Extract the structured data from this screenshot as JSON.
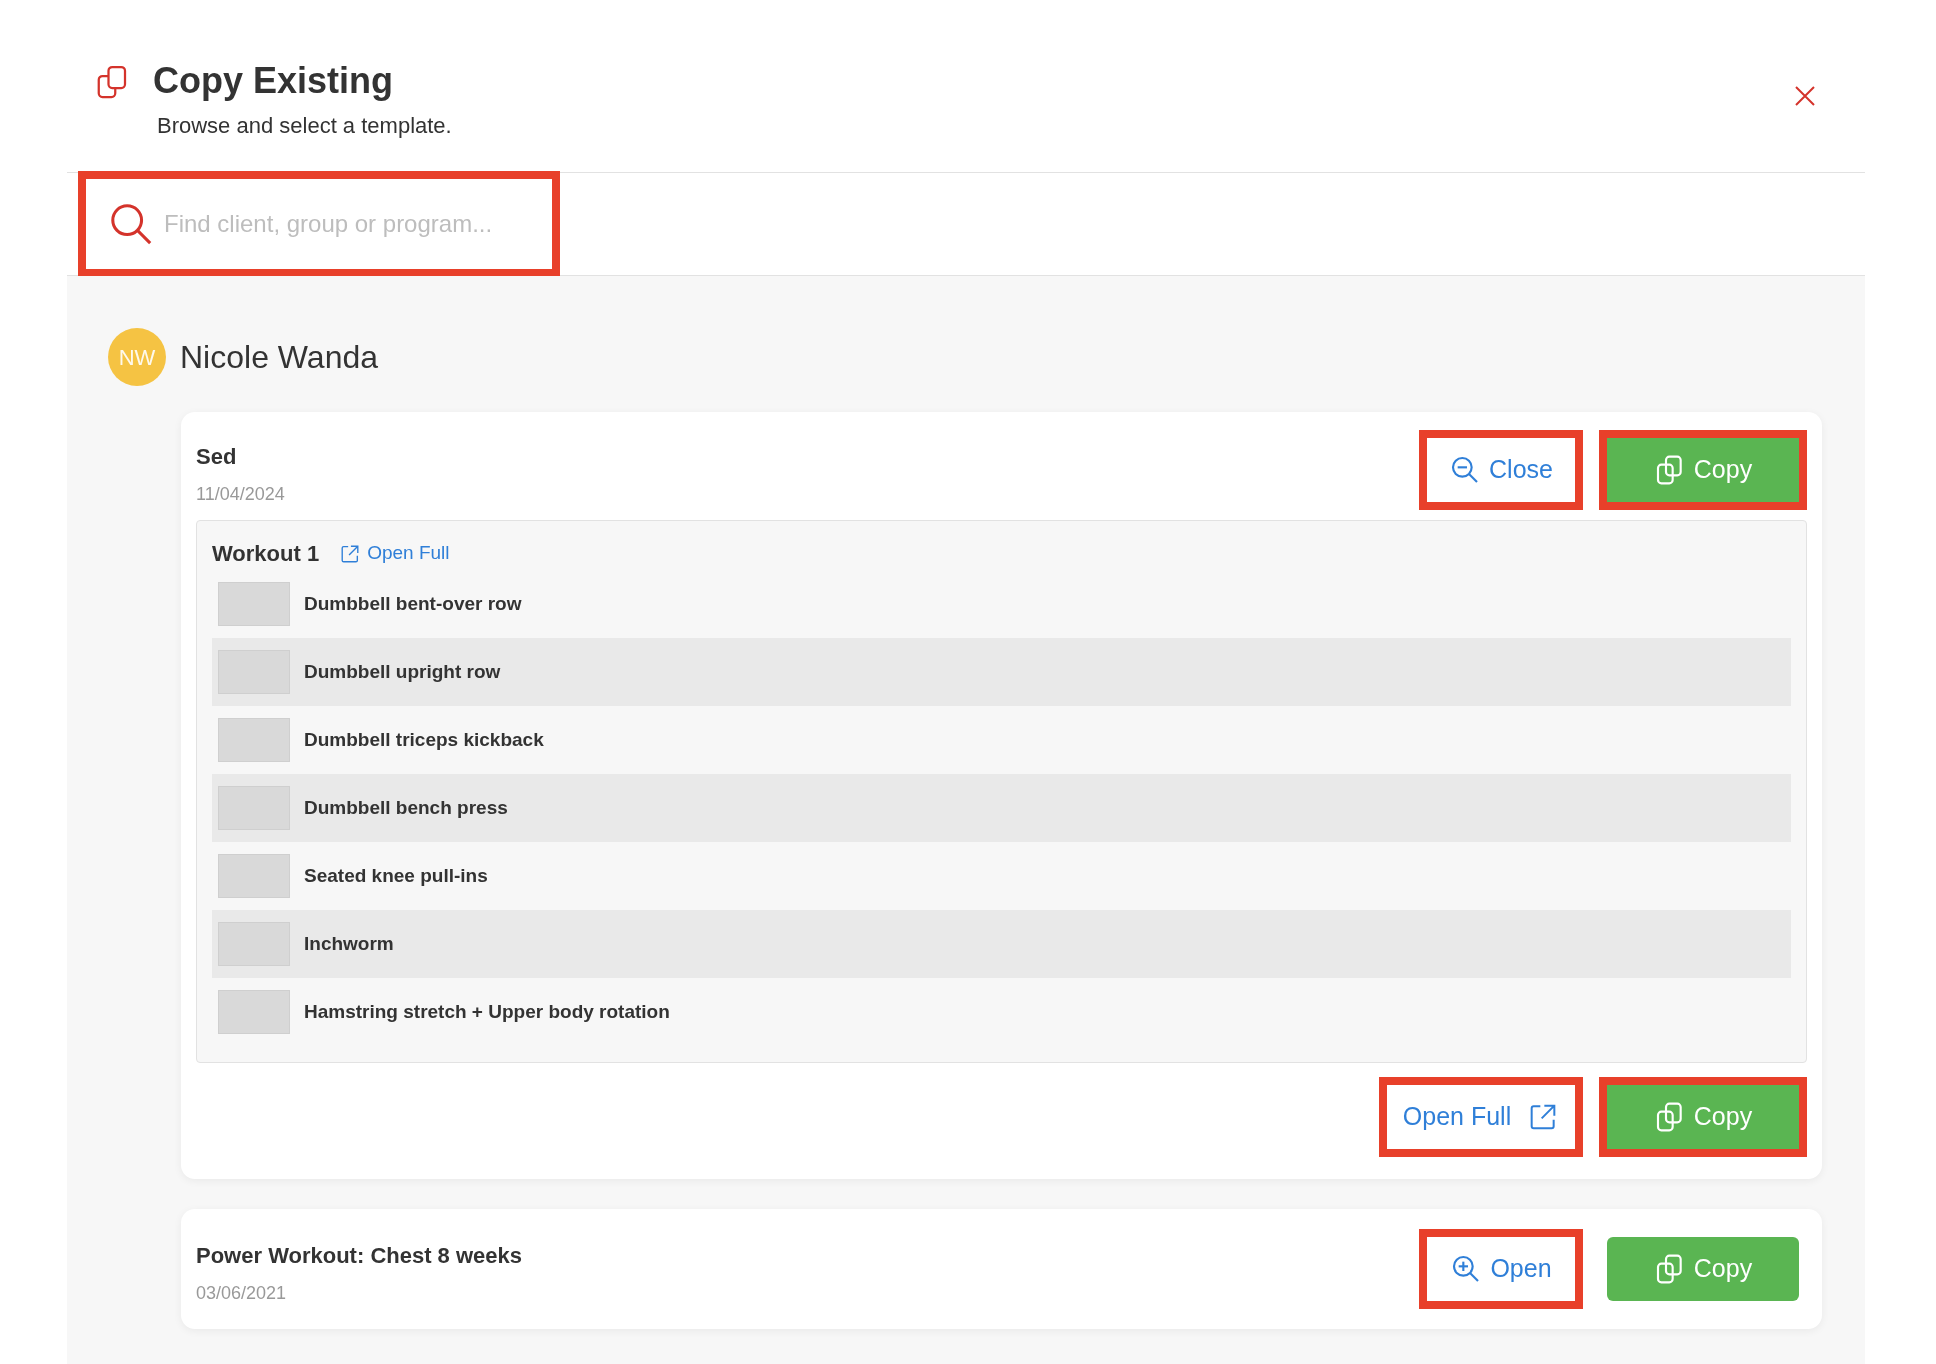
{
  "header": {
    "title": "Copy Existing",
    "subtitle": "Browse and select a template."
  },
  "search": {
    "placeholder": "Find client, group or program...",
    "highlighted": true
  },
  "client": {
    "initials": "NW",
    "name": "Nicole Wanda",
    "color": "#f5c343"
  },
  "programs": [
    {
      "title": "Sed",
      "date": "11/04/2024",
      "expanded": true,
      "actions": [
        {
          "kind": "toggle",
          "label": "Close",
          "highlighted": true
        },
        {
          "kind": "copy",
          "label": "Copy",
          "highlighted": true
        }
      ],
      "workout": {
        "title": "Workout 1",
        "link": "Open Full",
        "exercises": [
          "Dumbbell bent-over row",
          "Dumbbell upright row",
          "Dumbbell triceps kickback",
          "Dumbbell bench press",
          "Seated knee pull-ins",
          "Inchworm",
          "Hamstring stretch + Upper body rotation"
        ]
      },
      "footer_actions": [
        {
          "kind": "open_full",
          "label": "Open Full",
          "highlighted": true
        },
        {
          "kind": "copy",
          "label": "Copy",
          "highlighted": true
        }
      ]
    },
    {
      "title": "Power Workout: Chest 8 weeks",
      "date": "03/06/2021",
      "expanded": false,
      "actions": [
        {
          "kind": "toggle",
          "label": "Open",
          "highlighted": true
        },
        {
          "kind": "copy",
          "label": "Copy",
          "highlighted": false
        }
      ]
    }
  ]
}
